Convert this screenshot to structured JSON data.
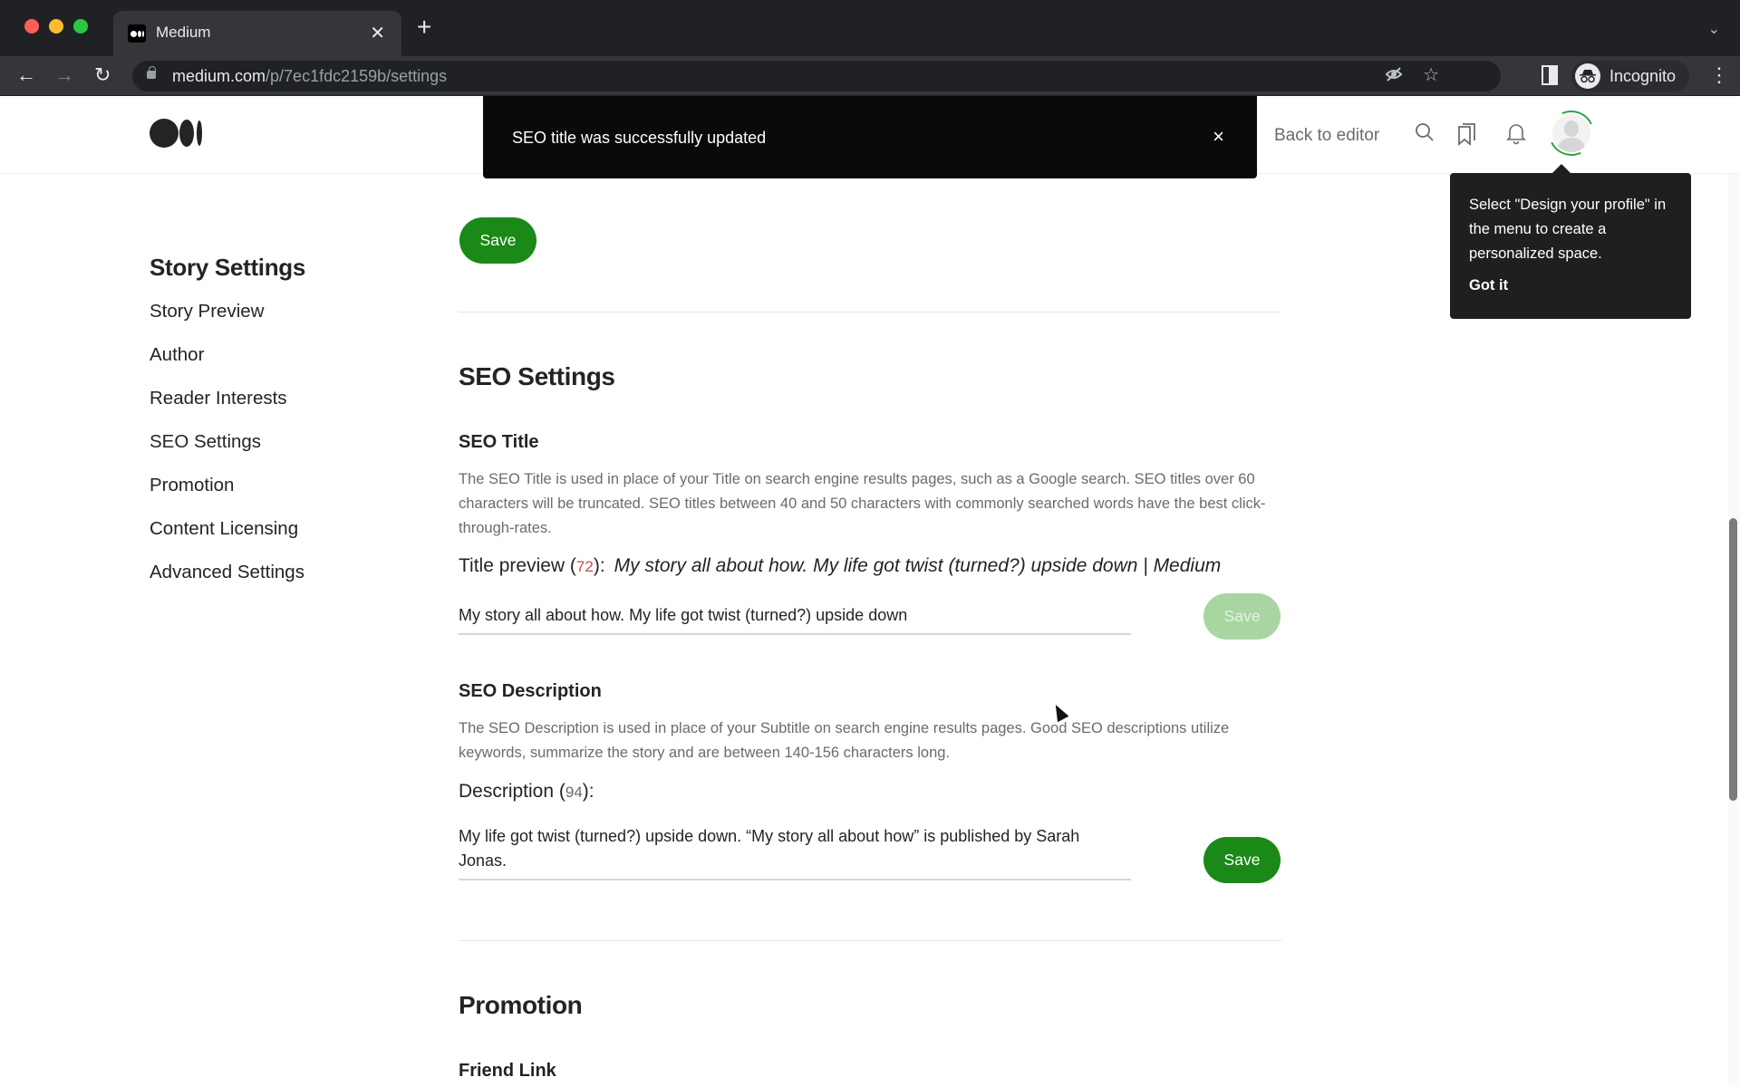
{
  "browser": {
    "tab_title": "Medium",
    "new_tab_label": "+",
    "url_host": "medium.com",
    "url_path": "/p/7ec1fdc2159b/settings",
    "profile_label": "Incognito"
  },
  "header": {
    "back_to_editor": "Back to editor"
  },
  "toast": {
    "message": "SEO title was successfully updated",
    "close_label": "×"
  },
  "tooltip": {
    "text": "Select \"Design your profile\" in the menu to create a personalized space.",
    "button": "Got it"
  },
  "sidebar": {
    "title": "Story Settings",
    "items": [
      {
        "label": "Story Preview"
      },
      {
        "label": "Author"
      },
      {
        "label": "Reader Interests"
      },
      {
        "label": "SEO Settings"
      },
      {
        "label": "Promotion"
      },
      {
        "label": "Content Licensing"
      },
      {
        "label": "Advanced Settings"
      }
    ]
  },
  "main": {
    "top_save_label": "Save",
    "seo": {
      "heading": "SEO Settings",
      "title": {
        "heading": "SEO Title",
        "description": "The SEO Title is used in place of your Title on search engine results pages, such as a Google search. SEO titles over 60 characters will be truncated. SEO titles between 40 and 50 characters with commonly searched words have the best click-through-rates.",
        "preview_label": "Title preview (",
        "preview_count": "72",
        "preview_suffix": "):",
        "preview_text": "My story all about how. My life got twist (turned?) upside down | Medium",
        "value": "My story all about how. My life got twist (turned?) upside down",
        "save_label": "Save",
        "save_disabled": true
      },
      "description": {
        "heading": "SEO Description",
        "description": "The SEO Description is used in place of your Subtitle on search engine results pages. Good SEO descriptions utilize keywords, summarize the story and are between 140-156 characters long.",
        "label": "Description (",
        "count": "94",
        "suffix": "):",
        "value": "My life got twist (turned?) upside down. “My story all about how” is published by Sarah Jonas.",
        "save_label": "Save"
      }
    },
    "promotion": {
      "heading": "Promotion",
      "friend_link_heading": "Friend Link"
    }
  },
  "colors": {
    "accent_green": "#1a8917",
    "accent_green_disabled": "#a8d5a2",
    "count_over_limit": "#c94a4a"
  }
}
